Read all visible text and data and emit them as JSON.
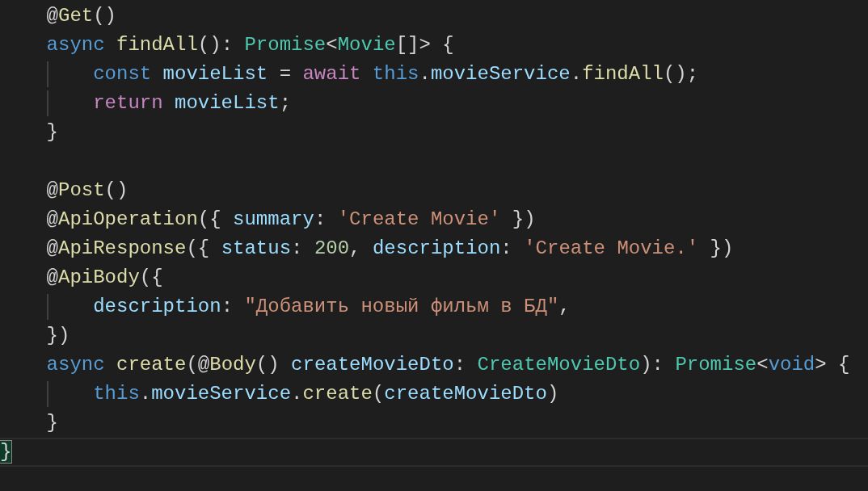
{
  "editor": {
    "lines": [
      {
        "kind": "code",
        "current": false,
        "tokens": [
          {
            "kind": "punct",
            "text": "@"
          },
          {
            "kind": "fn",
            "text": "Get"
          },
          {
            "kind": "punct",
            "text": "()"
          }
        ]
      },
      {
        "kind": "code",
        "current": false,
        "tokens": [
          {
            "kind": "kw",
            "text": "async"
          },
          {
            "kind": "fn",
            "text": " findAll"
          },
          {
            "kind": "punct",
            "text": "(): "
          },
          {
            "kind": "type",
            "text": "Promise"
          },
          {
            "kind": "punct",
            "text": "<"
          },
          {
            "kind": "type",
            "text": "Movie"
          },
          {
            "kind": "punct",
            "text": "[]> {"
          }
        ],
        "children": [
          {
            "kind": "code",
            "current": false,
            "tokens": [
              {
                "kind": "kw",
                "text": "const"
              },
              {
                "kind": "var",
                "text": " movieList"
              },
              {
                "kind": "punct",
                "text": " = "
              },
              {
                "kind": "ctrl",
                "text": "await"
              },
              {
                "kind": "kw",
                "text": " this"
              },
              {
                "kind": "punct",
                "text": "."
              },
              {
                "kind": "var",
                "text": "movieService"
              },
              {
                "kind": "punct",
                "text": "."
              },
              {
                "kind": "fn",
                "text": "findAll"
              },
              {
                "kind": "punct",
                "text": "();"
              }
            ]
          },
          {
            "kind": "code",
            "current": false,
            "tokens": [
              {
                "kind": "ctrl",
                "text": "return"
              },
              {
                "kind": "var",
                "text": " movieList"
              },
              {
                "kind": "punct",
                "text": ";"
              }
            ]
          }
        ]
      },
      {
        "kind": "code",
        "current": false,
        "tokens": [
          {
            "kind": "punct",
            "text": "}"
          }
        ]
      },
      {
        "kind": "blank",
        "current": false
      },
      {
        "kind": "code",
        "current": false,
        "tokens": [
          {
            "kind": "punct",
            "text": "@"
          },
          {
            "kind": "fn",
            "text": "Post"
          },
          {
            "kind": "punct",
            "text": "()"
          }
        ]
      },
      {
        "kind": "code",
        "current": false,
        "tokens": [
          {
            "kind": "punct",
            "text": "@"
          },
          {
            "kind": "fn",
            "text": "ApiOperation"
          },
          {
            "kind": "punct",
            "text": "({ "
          },
          {
            "kind": "var",
            "text": "summary"
          },
          {
            "kind": "punct",
            "text": ": "
          },
          {
            "kind": "str",
            "text": "'Create Movie'"
          },
          {
            "kind": "punct",
            "text": " })"
          }
        ]
      },
      {
        "kind": "code",
        "current": false,
        "tokens": [
          {
            "kind": "punct",
            "text": "@"
          },
          {
            "kind": "fn",
            "text": "ApiResponse"
          },
          {
            "kind": "punct",
            "text": "({ "
          },
          {
            "kind": "var",
            "text": "status"
          },
          {
            "kind": "punct",
            "text": ": "
          },
          {
            "kind": "num",
            "text": "200"
          },
          {
            "kind": "punct",
            "text": ", "
          },
          {
            "kind": "var",
            "text": "description"
          },
          {
            "kind": "punct",
            "text": ": "
          },
          {
            "kind": "str",
            "text": "'Create Movie.'"
          },
          {
            "kind": "punct",
            "text": " })"
          }
        ]
      },
      {
        "kind": "code",
        "current": false,
        "tokens": [
          {
            "kind": "punct",
            "text": "@"
          },
          {
            "kind": "fn",
            "text": "ApiBody"
          },
          {
            "kind": "punct",
            "text": "({"
          }
        ],
        "children": [
          {
            "kind": "code",
            "current": false,
            "tokens": [
              {
                "kind": "var",
                "text": "description"
              },
              {
                "kind": "punct",
                "text": ": "
              },
              {
                "kind": "str",
                "text": "\"Добавить новый фильм в БД\""
              },
              {
                "kind": "punct",
                "text": ","
              }
            ]
          }
        ]
      },
      {
        "kind": "code",
        "current": false,
        "tokens": [
          {
            "kind": "punct",
            "text": "})"
          }
        ]
      },
      {
        "kind": "code",
        "current": false,
        "tokens": [
          {
            "kind": "kw",
            "text": "async"
          },
          {
            "kind": "fn",
            "text": " create"
          },
          {
            "kind": "punct",
            "text": "(@"
          },
          {
            "kind": "fn",
            "text": "Body"
          },
          {
            "kind": "punct",
            "text": "() "
          },
          {
            "kind": "var",
            "text": "createMovieDto"
          },
          {
            "kind": "punct",
            "text": ": "
          },
          {
            "kind": "type",
            "text": "CreateMovieDto"
          },
          {
            "kind": "punct",
            "text": "): "
          },
          {
            "kind": "type",
            "text": "Promise"
          },
          {
            "kind": "punct",
            "text": "<"
          },
          {
            "kind": "kw",
            "text": "void"
          },
          {
            "kind": "punct",
            "text": "> {"
          }
        ],
        "children": [
          {
            "kind": "code",
            "current": false,
            "tokens": [
              {
                "kind": "kw",
                "text": "this"
              },
              {
                "kind": "punct",
                "text": "."
              },
              {
                "kind": "var",
                "text": "movieService"
              },
              {
                "kind": "punct",
                "text": "."
              },
              {
                "kind": "fn",
                "text": "create"
              },
              {
                "kind": "punct",
                "text": "("
              },
              {
                "kind": "var",
                "text": "createMovieDto"
              },
              {
                "kind": "punct",
                "text": ")"
              }
            ]
          }
        ]
      },
      {
        "kind": "code",
        "current": false,
        "tokens": [
          {
            "kind": "punct",
            "text": "}"
          }
        ]
      }
    ],
    "closing_line": {
      "kind": "code",
      "current": true,
      "tokens": [
        {
          "kind": "bracket-match",
          "text": "}"
        }
      ]
    }
  }
}
